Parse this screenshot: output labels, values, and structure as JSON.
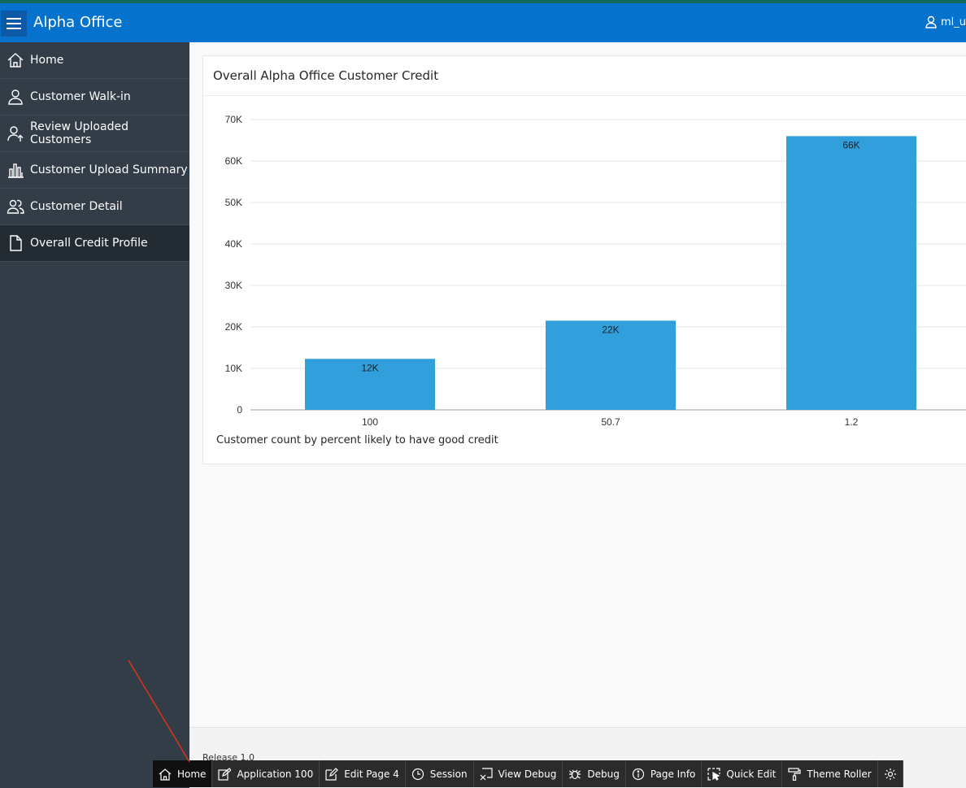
{
  "header": {
    "app_title": "Alpha Office",
    "user_label": "ml_u"
  },
  "sidebar": {
    "items": [
      {
        "label": "Home",
        "icon": "home-icon"
      },
      {
        "label": "Customer Walk-in",
        "icon": "user-icon"
      },
      {
        "label": "Review Uploaded Customers",
        "icon": "user-upload-icon"
      },
      {
        "label": "Customer Upload Summary",
        "icon": "bar-chart-icon"
      },
      {
        "label": "Customer Detail",
        "icon": "users-icon"
      },
      {
        "label": "Overall Credit Profile",
        "icon": "document-icon",
        "active": true
      }
    ]
  },
  "region": {
    "title": "Overall Alpha Office Customer Credit"
  },
  "chart_data": {
    "type": "bar",
    "categories": [
      "100",
      "50.7",
      "1.2"
    ],
    "values": [
      12300,
      21500,
      66000
    ],
    "data_labels": [
      "12K",
      "22K",
      "66K"
    ],
    "y_ticks": [
      "0",
      "10K",
      "20K",
      "30K",
      "40K",
      "50K",
      "60K",
      "70K"
    ],
    "ylim": [
      0,
      70000
    ],
    "caption": "Customer count by percent likely to have good credit",
    "bar_color": "#309fdb",
    "grid": true
  },
  "footer": {
    "release": "Release 1.0"
  },
  "devbar": {
    "items": [
      {
        "label": "Home",
        "icon": "home-icon"
      },
      {
        "label": "Application 100",
        "icon": "edit-icon"
      },
      {
        "label": "Edit Page 4",
        "icon": "edit-page-icon"
      },
      {
        "label": "Session",
        "icon": "clock-icon"
      },
      {
        "label": "View Debug",
        "icon": "view-debug-icon"
      },
      {
        "label": "Debug",
        "icon": "bug-icon"
      },
      {
        "label": "Page Info",
        "icon": "info-icon"
      },
      {
        "label": "Quick Edit",
        "icon": "quick-edit-icon"
      },
      {
        "label": "Theme Roller",
        "icon": "paint-roller-icon"
      },
      {
        "label": "",
        "icon": "gear-icon"
      }
    ]
  },
  "colors": {
    "header": "#0572ce",
    "sidebar": "#323d47",
    "accent_bar": "#309fdb",
    "annotation_arrow": "#e0301e"
  }
}
